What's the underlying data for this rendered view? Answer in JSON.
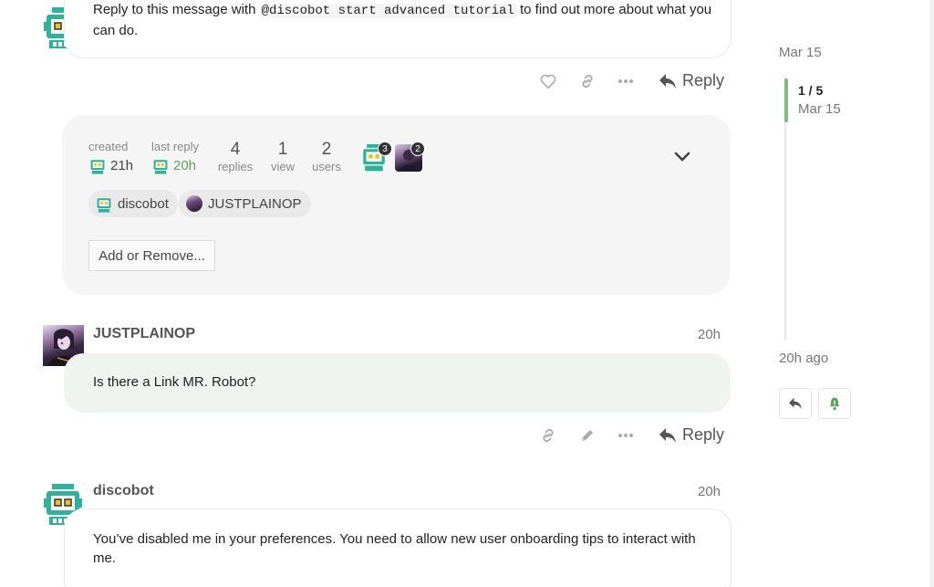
{
  "post1": {
    "text_before": "Reply to this message with ",
    "code": "@discobot start advanced tutorial",
    "text_after": " to find out more about what you",
    "text_line2": "can do.",
    "reply_label": "Reply"
  },
  "summary": {
    "created_label": "created",
    "created_value": "21h",
    "last_reply_label": "last reply",
    "last_reply_value": "20h",
    "replies_num": "4",
    "replies_label": "replies",
    "views_num": "1",
    "views_label": "view",
    "users_num": "2",
    "users_label": "users",
    "participant1_count": "3",
    "participant2_count": "2",
    "participants": [
      "discobot",
      "JUSTPLAINOP"
    ],
    "add_remove_label": "Add or Remove..."
  },
  "post2": {
    "username": "JUSTPLAINOP",
    "date": "20h",
    "text": "Is there a Link MR. Robot?",
    "reply_label": "Reply"
  },
  "post3": {
    "username": "discobot",
    "date": "20h",
    "text_line1": "You’ve disabled me in your preferences. You need to allow new user onboarding tips to interact with",
    "text_line2": "me."
  },
  "timeline": {
    "top_date": "Mar 15",
    "position": "1 / 5",
    "position_date": "Mar 15",
    "bottom_label": "20h ago"
  },
  "colors": {
    "accent_green": "#7bbf7b",
    "robot_teal": "#2bb39b",
    "last_reply_green": "#5aa55a"
  }
}
